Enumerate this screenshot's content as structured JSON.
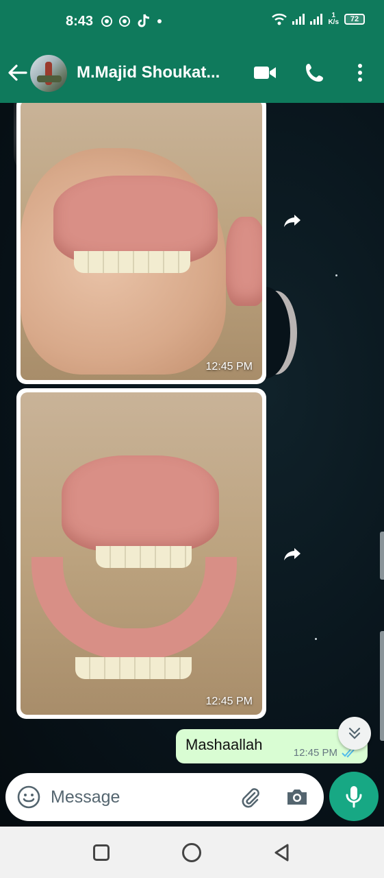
{
  "status_bar": {
    "time": "8:43",
    "network_speed_value": "1",
    "network_speed_unit": "K/s",
    "battery": "72"
  },
  "header": {
    "contact_name": "M.Majid Shoukat...",
    "icons": [
      "back-arrow-icon",
      "video-call-icon",
      "voice-call-icon",
      "more-vert-icon"
    ]
  },
  "messages": [
    {
      "type": "image",
      "direction": "incoming",
      "time": "12:45 PM"
    },
    {
      "type": "image",
      "direction": "incoming",
      "time": "12:45 PM"
    },
    {
      "type": "text",
      "direction": "outgoing",
      "text": "Mashaallah",
      "time": "12:45 PM",
      "status": "read"
    }
  ],
  "composer": {
    "placeholder": "Message"
  },
  "colors": {
    "header": "#0f7a5c",
    "outgoing_bubble": "#d9fdd3",
    "mic_button": "#17a884",
    "read_ticks": "#53bdeb"
  }
}
